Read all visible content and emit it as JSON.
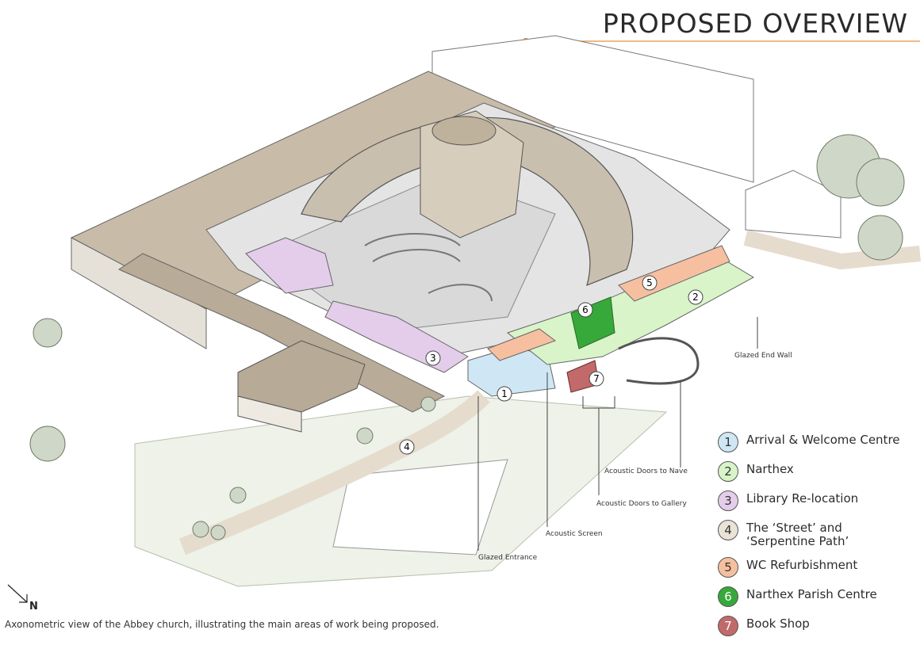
{
  "title": "PROPOSED OVERVIEW",
  "accent_color": "#e8903c",
  "callouts": {
    "glazed_end_wall": "Glazed End Wall",
    "acoustic_doors_nave": "Acoustic Doors to Nave",
    "acoustic_doors_gallery": "Acoustic Doors to Gallery",
    "acoustic_screen": "Acoustic Screen",
    "glazed_entrance": "Glazed Entrance"
  },
  "legend": [
    {
      "num": "1",
      "label": "Arrival & Welcome Centre",
      "color": "#cfe6f4"
    },
    {
      "num": "2",
      "label": "Narthex",
      "color": "#d8f4c8"
    },
    {
      "num": "3",
      "label": "Library Re-location",
      "color": "#e4cdea"
    },
    {
      "num": "4",
      "label": "The ‘Street’ and\n‘Serpentine Path’",
      "color": "#e9e2d6"
    },
    {
      "num": "5",
      "label": "WC Refurbishment",
      "color": "#f6c0a0"
    },
    {
      "num": "6",
      "label": "Narthex Parish Centre",
      "color": "#37a83a"
    },
    {
      "num": "7",
      "label": "Book Shop",
      "color": "#c26a6a"
    }
  ],
  "north_label": "N",
  "caption": "Axonometric view of the Abbey church, illustrating the main areas of work being proposed."
}
